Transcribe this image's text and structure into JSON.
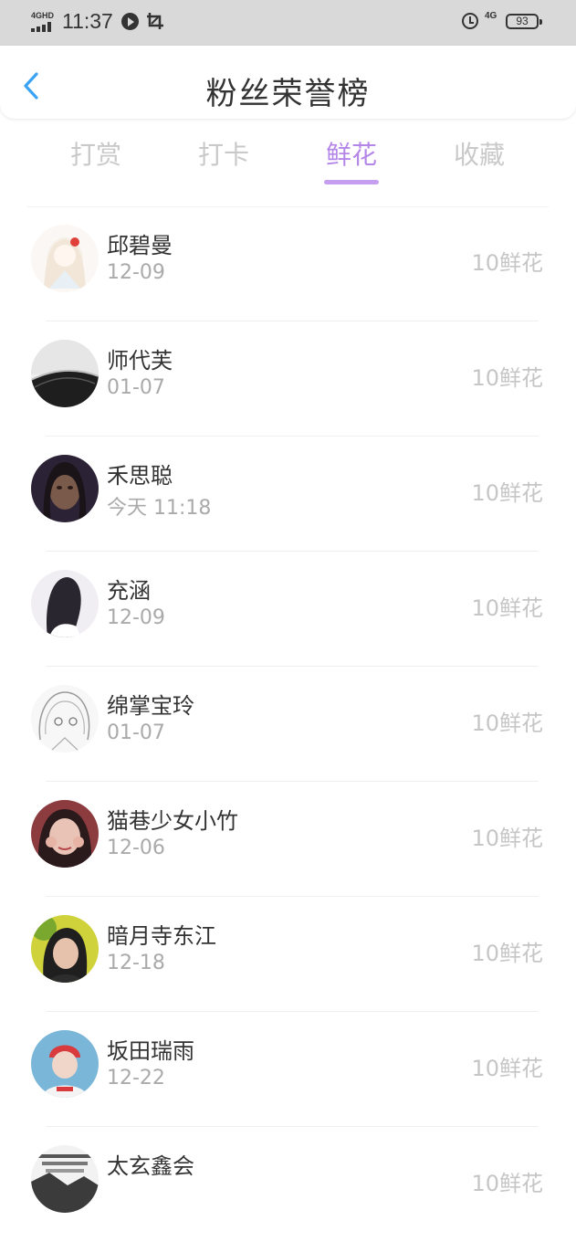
{
  "status_bar": {
    "network": "4GHD",
    "time": "11:37",
    "signal_4g": "4G",
    "battery": "93"
  },
  "header": {
    "title": "粉丝荣誉榜"
  },
  "tabs": [
    {
      "label": "打赏",
      "active": false
    },
    {
      "label": "打卡",
      "active": false
    },
    {
      "label": "鲜花",
      "active": true
    },
    {
      "label": "收藏",
      "active": false
    }
  ],
  "colors": {
    "accent": "#b486e8",
    "tab_inactive": "#c9c9c9",
    "back_icon": "#3aa3f5"
  },
  "list": [
    {
      "name": "邱碧曼",
      "date": "12-09",
      "value": "10鲜花",
      "avatar": "anime-girl-red-flower-avatar"
    },
    {
      "name": "师代芙",
      "date": "01-07",
      "value": "10鲜花",
      "avatar": "bridge-landscape-avatar"
    },
    {
      "name": "禾思聪",
      "date": "今天 11:18",
      "value": "10鲜花",
      "avatar": "dark-portrait-avatar"
    },
    {
      "name": "充涵",
      "date": "12-09",
      "value": "10鲜花",
      "avatar": "black-hair-girl-avatar"
    },
    {
      "name": "绵掌宝玲",
      "date": "01-07",
      "value": "10鲜花",
      "avatar": "sketch-anime-avatar"
    },
    {
      "name": "猫巷少女小竹",
      "date": "12-06",
      "value": "10鲜花",
      "avatar": "girl-red-background-avatar"
    },
    {
      "name": "暗月寺东江",
      "date": "12-18",
      "value": "10鲜花",
      "avatar": "boy-yellow-background-avatar"
    },
    {
      "name": "坂田瑞雨",
      "date": "12-22",
      "value": "10鲜花",
      "avatar": "red-hair-boy-blue-avatar"
    },
    {
      "name": "太玄鑫会",
      "date": "",
      "value": "10鲜花",
      "avatar": "text-image-avatar"
    }
  ]
}
